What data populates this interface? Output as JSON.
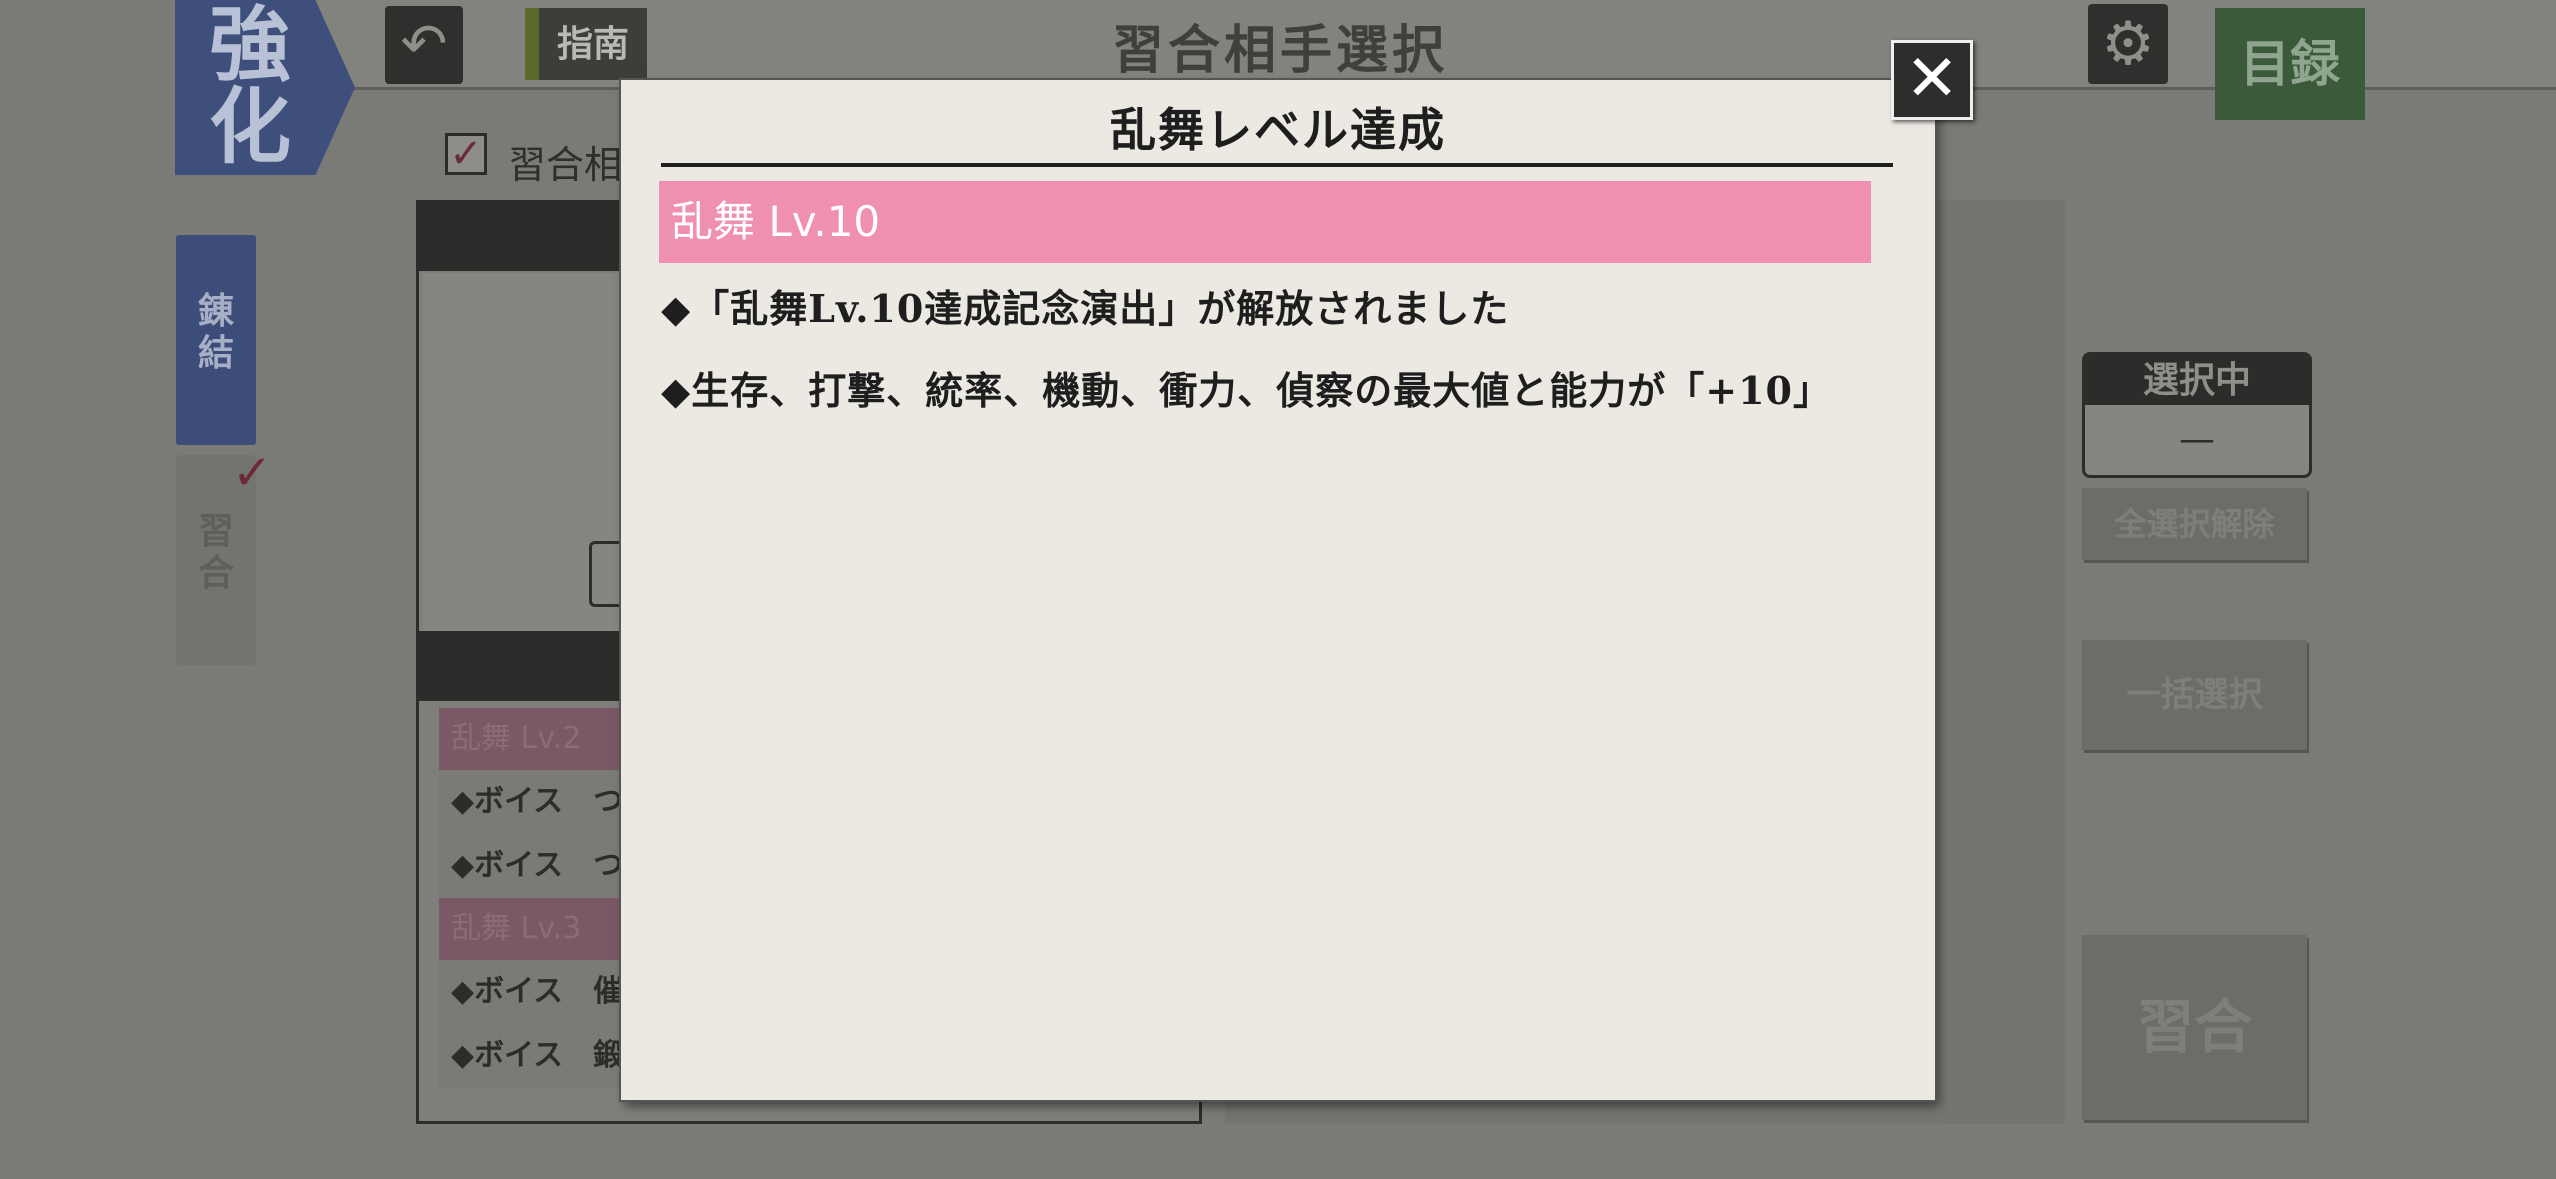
{
  "screen": {
    "title": "習合相手選択",
    "strengthen_tab": [
      "強",
      "化"
    ],
    "back_icon": "undo-arrow-icon",
    "guide_label": "指南",
    "settings_icon": "gear-icon",
    "catalog_label": "目録"
  },
  "options": {
    "fusion_partner_check_label": "習合相"
  },
  "side_tabs": {
    "link": "錬結",
    "fuse": "習合"
  },
  "left_list": [
    {
      "type": "level",
      "text": "乱舞 Lv.2"
    },
    {
      "type": "item",
      "text": "◆ボイス　つ"
    },
    {
      "type": "item",
      "text": "◆ボイス　つ"
    },
    {
      "type": "level",
      "text": "乱舞 Lv.3"
    },
    {
      "type": "item",
      "text": "◆ボイス　催"
    },
    {
      "type": "item",
      "text": "◆ボイス　鍛"
    }
  ],
  "selection": {
    "title": "選択中",
    "value": "—",
    "clear_all_label": "全選択解除",
    "bulk_select_label": "一括選択",
    "fuse_label": "習合"
  },
  "modal": {
    "title": "乱舞レベル達成",
    "level": "乱舞 Lv.10",
    "rewards": [
      "◆「乱舞Lv.10達成記念演出」が解放されました",
      "◆生存、打撃、統率、機動、衝力、偵察の最大値と能力が「+10」"
    ],
    "close_icon": "close-icon",
    "level_color": "#ef8fb2"
  }
}
